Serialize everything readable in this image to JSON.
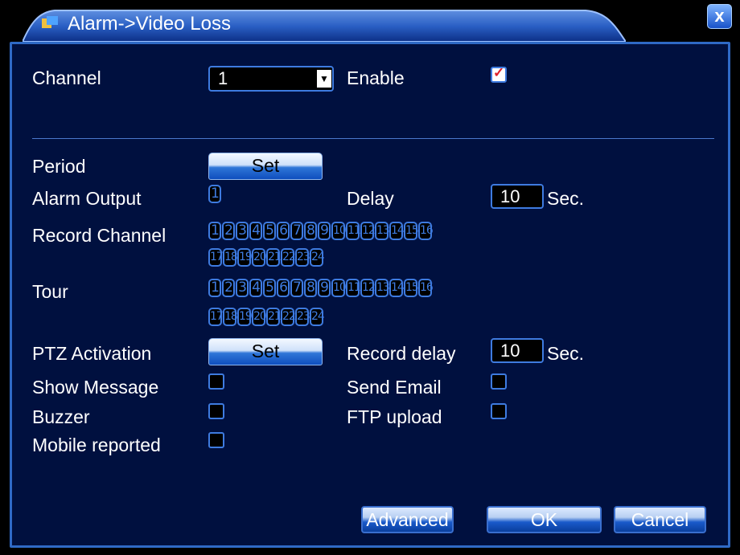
{
  "window": {
    "title": "Alarm->Video Loss",
    "icon": "alarm-icon",
    "close_label": "x"
  },
  "channel": {
    "label": "Channel",
    "value": "1",
    "dropdown_icon": "chevron-down-icon"
  },
  "enable": {
    "label": "Enable",
    "checked": true
  },
  "period": {
    "label": "Period",
    "button": "Set"
  },
  "alarm_output": {
    "label": "Alarm Output",
    "channels": [
      "1"
    ]
  },
  "delay": {
    "label": "Delay",
    "value": "10",
    "unit": "Sec."
  },
  "record_channel": {
    "label": "Record Channel",
    "row1": [
      "1",
      "2",
      "3",
      "4",
      "5",
      "6",
      "7",
      "8",
      "9",
      "10",
      "11",
      "12",
      "13",
      "14",
      "15",
      "16"
    ],
    "row2": [
      "17",
      "18",
      "19",
      "20",
      "21",
      "22",
      "23",
      "24"
    ]
  },
  "tour": {
    "label": "Tour",
    "row1": [
      "1",
      "2",
      "3",
      "4",
      "5",
      "6",
      "7",
      "8",
      "9",
      "10",
      "11",
      "12",
      "13",
      "14",
      "15",
      "16"
    ],
    "row2": [
      "17",
      "18",
      "19",
      "20",
      "21",
      "22",
      "23",
      "24"
    ]
  },
  "ptz": {
    "label": "PTZ Activation",
    "button": "Set"
  },
  "record_delay": {
    "label": "Record delay",
    "value": "10",
    "unit": "Sec."
  },
  "show_message": {
    "label": "Show Message",
    "checked": false
  },
  "send_email": {
    "label": "Send Email",
    "checked": false
  },
  "buzzer": {
    "label": "Buzzer",
    "checked": false
  },
  "ftp_upload": {
    "label": "FTP upload",
    "checked": false
  },
  "mobile_reported": {
    "label": "Mobile reported",
    "checked": false
  },
  "footer": {
    "advanced": "Advanced",
    "ok": "OK",
    "cancel": "Cancel"
  },
  "colors": {
    "panel": "#00103f",
    "border": "#3e7be0",
    "text": "#ffffff"
  }
}
